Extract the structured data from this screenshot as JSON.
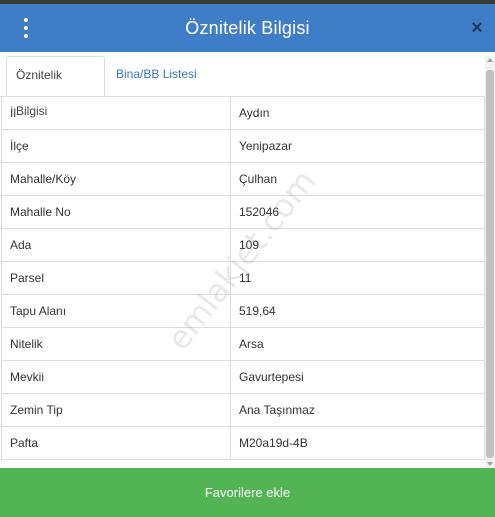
{
  "header": {
    "title": "Öznitelik Bilgisi",
    "close_label": "×"
  },
  "tabs": [
    {
      "label": "Öznitelik Bilgisi",
      "active": true
    },
    {
      "label": "Bina/BB Listesi",
      "active": false
    }
  ],
  "attributes": [
    {
      "key": "İl",
      "value": "Aydın"
    },
    {
      "key": "İlçe",
      "value": "Yenipazar"
    },
    {
      "key": "Mahalle/Köy",
      "value": "Çulhan"
    },
    {
      "key": "Mahalle No",
      "value": "152046"
    },
    {
      "key": "Ada",
      "value": "109"
    },
    {
      "key": "Parsel",
      "value": "11"
    },
    {
      "key": "Tapu Alanı",
      "value": "519,64"
    },
    {
      "key": "Nitelik",
      "value": "Arsa"
    },
    {
      "key": "Mevkii",
      "value": "Gavurtepesi"
    },
    {
      "key": "Zemin Tip",
      "value": "Ana Taşınmaz"
    },
    {
      "key": "Pafta",
      "value": "M20a19d-4B"
    }
  ],
  "watermark": "emlakjet.com",
  "footer": {
    "favorite_label": "Favorilere ekle"
  },
  "colors": {
    "header": "#3f7ec6",
    "favorite_button": "#53b453",
    "tab_link": "#3a78b8"
  },
  "icons": {
    "menu": "kebab-menu-icon",
    "close": "close-icon"
  }
}
